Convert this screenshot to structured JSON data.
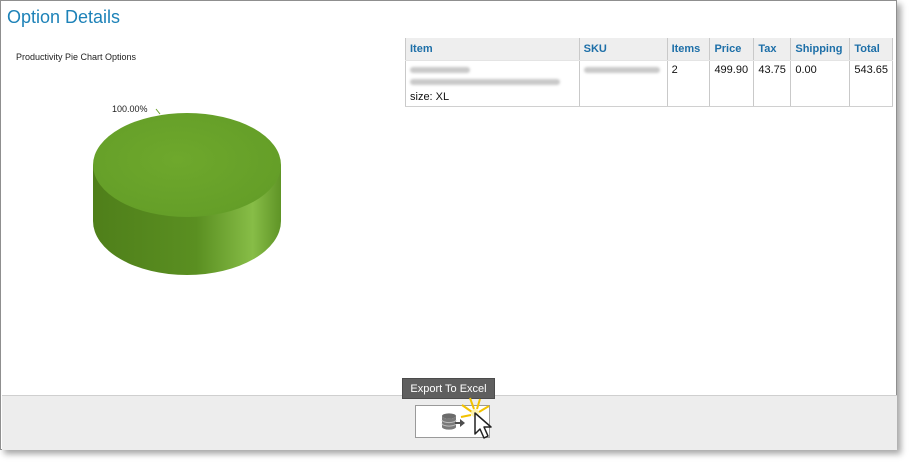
{
  "page": {
    "title": "Option Details"
  },
  "chart_data": {
    "type": "pie",
    "title": "Productivity Pie Chart Options",
    "slices": [
      {
        "value": 100.0,
        "label": "100.00%",
        "color": "#6aa22a"
      }
    ]
  },
  "table": {
    "headers": [
      "Item",
      "SKU",
      "Items",
      "Price",
      "Tax",
      "Shipping",
      "Total"
    ],
    "rows": [
      {
        "item_size": "size: XL",
        "items": "2",
        "price": "499.90",
        "tax": "43.75",
        "shipping": "0.00",
        "total": "543.65"
      }
    ]
  },
  "footer": {
    "export_tooltip": "Export To Excel",
    "export_icon": "database-export-icon"
  },
  "colors": {
    "title": "#1d82b8",
    "header_text": "#1d6fa8",
    "pie_green": "#6aa22a"
  }
}
